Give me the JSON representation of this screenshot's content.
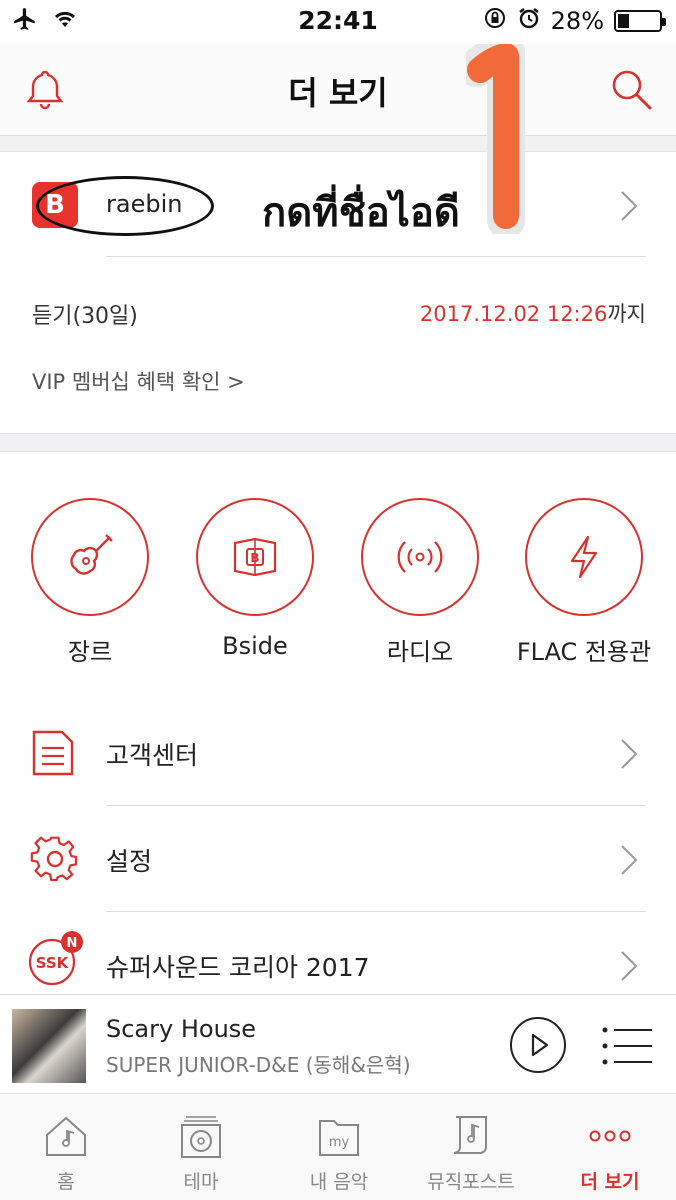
{
  "status": {
    "time": "22:41",
    "battery": "28%",
    "battery_level": 0.28,
    "icons": [
      "airplane-icon",
      "wifi-icon",
      "rotation-lock-icon",
      "alarm-icon",
      "battery-icon"
    ]
  },
  "header": {
    "title": "더 보기"
  },
  "profile": {
    "badge": "B",
    "username": "raebin"
  },
  "annotation": {
    "thai": "กดที่ชื่อไอดี",
    "number": "1"
  },
  "subscription": {
    "label": "듣기(30일)",
    "date": "2017.12.02 12:26",
    "date_suffix": "까지",
    "vip_link": "VIP 멤버십 혜택 확인 >"
  },
  "shortcuts": [
    {
      "label": "장르",
      "icon": "guitar-icon"
    },
    {
      "label": "Bside",
      "icon": "bside-icon"
    },
    {
      "label": "라디오",
      "icon": "radio-icon"
    },
    {
      "label": "FLAC 전용관",
      "icon": "lightning-icon"
    }
  ],
  "menu": [
    {
      "label": "고객센터",
      "icon": "document-icon"
    },
    {
      "label": "설정",
      "icon": "gear-icon"
    },
    {
      "label": "슈퍼사운드 코리아 2017",
      "icon": "ssk-icon",
      "badge": "N",
      "icon_text": "SSK"
    }
  ],
  "player": {
    "title": "Scary House",
    "artist": "SUPER JUNIOR-D&E (동해&은혁)"
  },
  "tabs": [
    {
      "label": "홈",
      "icon": "home-icon"
    },
    {
      "label": "테마",
      "icon": "theme-icon"
    },
    {
      "label": "내 음악",
      "icon": "my-music-icon",
      "icon_text": "my"
    },
    {
      "label": "뮤직포스트",
      "icon": "music-post-icon"
    },
    {
      "label": "더 보기",
      "icon": "more-icon",
      "active": true
    }
  ],
  "colors": {
    "accent": "#d8322e",
    "annotation_orange": "#f26a3a"
  }
}
